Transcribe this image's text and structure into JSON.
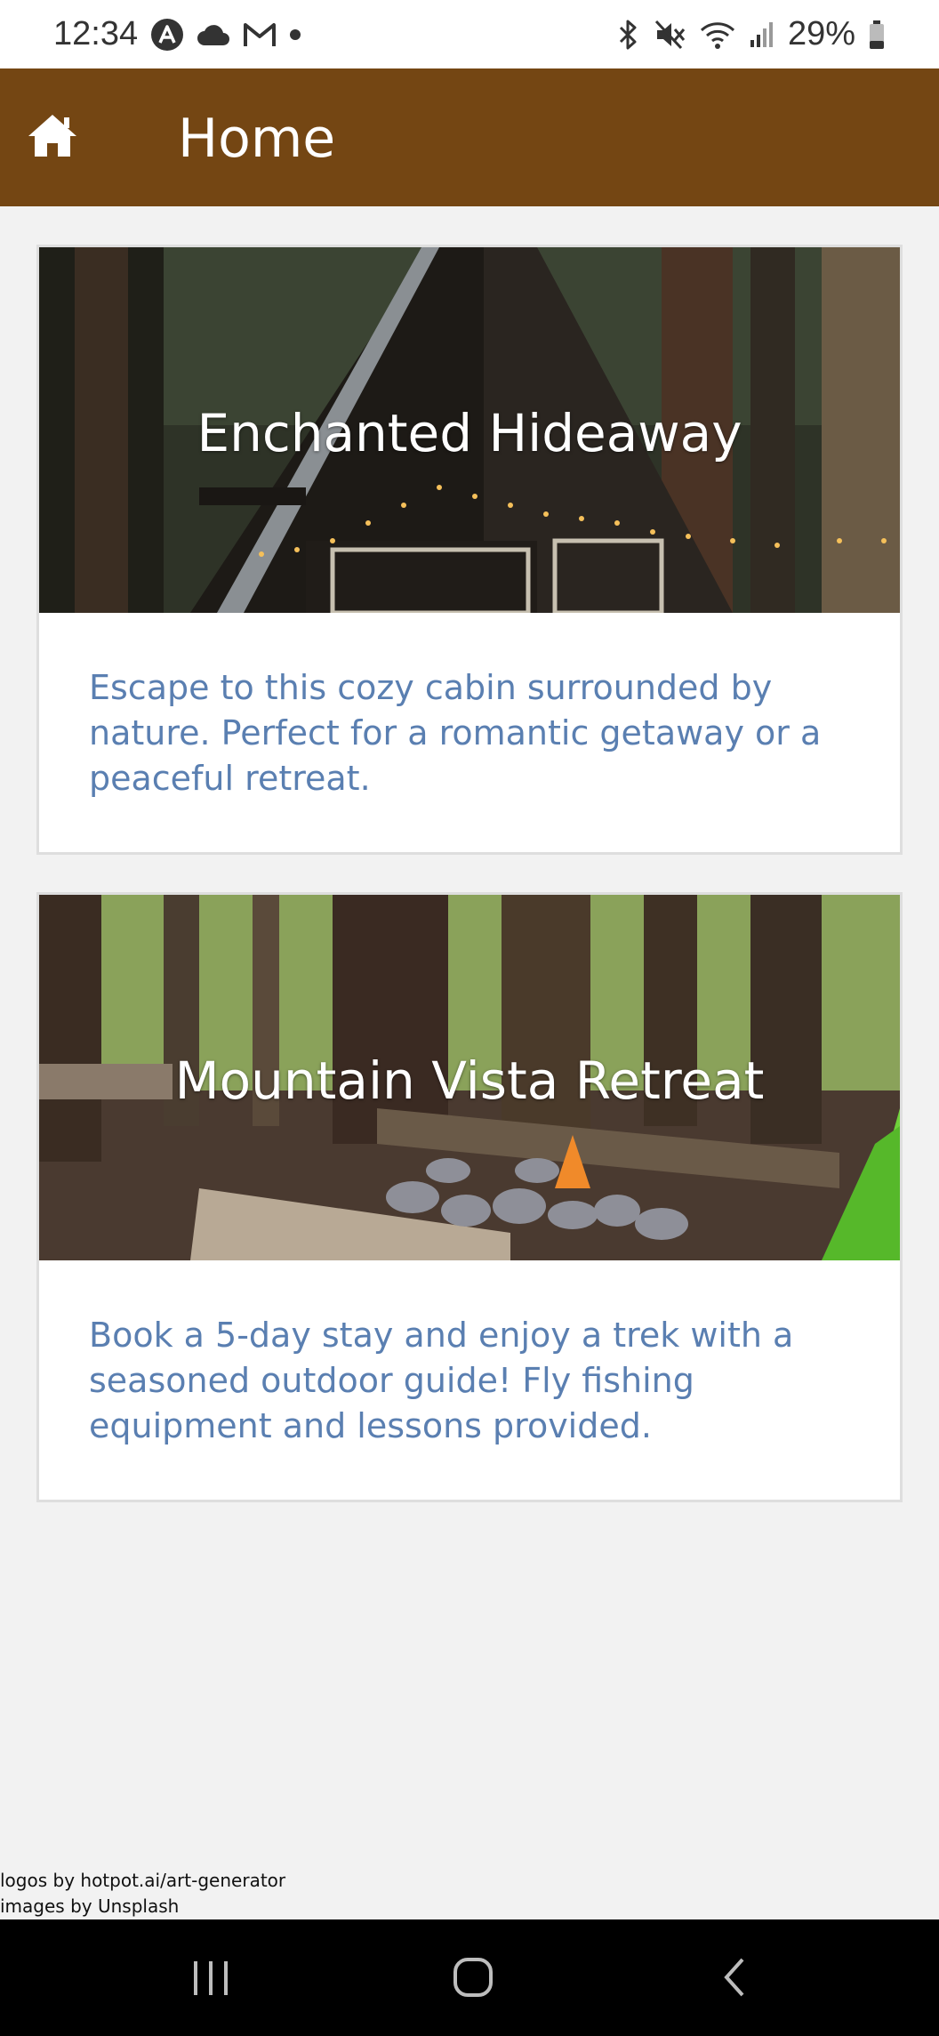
{
  "status_bar": {
    "time": "12:34",
    "battery": "29%"
  },
  "app_bar": {
    "title": "Home",
    "home_icon": "home-icon",
    "color": "#744613"
  },
  "cards": [
    {
      "title": "Enchanted Hideaway",
      "description": "Escape to this cozy cabin surrounded by nature. Perfect for a romantic getaway or a peaceful retreat."
    },
    {
      "title": "Mountain Vista Retreat",
      "description": "Book a 5-day stay and enjoy a trek with a seasoned outdoor guide! Fly fishing equipment and lessons provided."
    }
  ],
  "credits": {
    "logos": "logos by hotpot.ai/art-generator",
    "images": "images by Unsplash"
  },
  "colors": {
    "accent": "#744613",
    "description_text": "#5a7fb1"
  }
}
